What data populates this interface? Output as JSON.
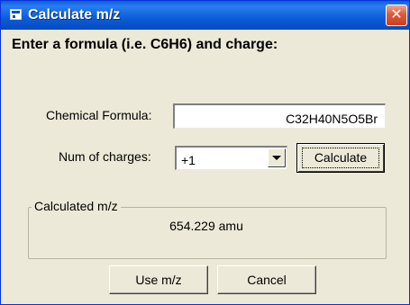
{
  "window": {
    "title": "Calculate m/z",
    "icon": "app-window-icon",
    "close_glyph": "✕"
  },
  "dialog": {
    "heading": "Enter a formula (i.e. C6H6) and charge:",
    "formula_label": "Chemical Formula:",
    "formula_value": "C32H40N5O5Br",
    "charges_label": "Num of charges:",
    "charges_selected": "+1",
    "calculate_label": "Calculate",
    "result_group_label": "Calculated m/z",
    "result_value": "654.229 amu",
    "use_button_label": "Use m/z",
    "cancel_button_label": "Cancel"
  },
  "colors": {
    "titlebar": "#0b5ed7",
    "dialog_bg": "#ece9d8",
    "close_button": "#e0593a"
  }
}
